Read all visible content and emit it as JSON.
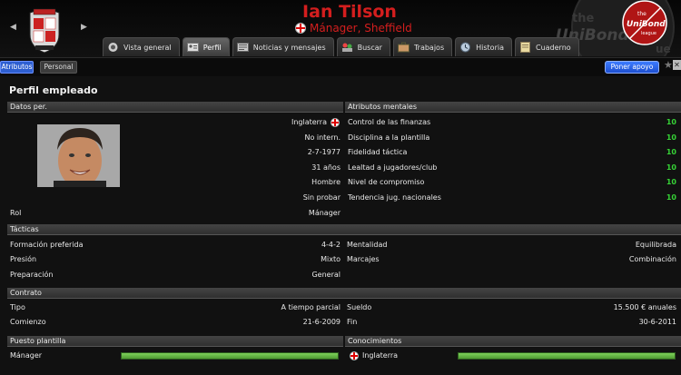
{
  "header": {
    "name": "Ian Tilson",
    "role_club": "Mánager, Sheffield",
    "watermark_top": "the",
    "watermark_mid": "UniBond",
    "watermark_bottom": "ue",
    "badge_top": "the",
    "badge_mid": "UniBond",
    "badge_bottom": "league"
  },
  "tabs": [
    {
      "label": "Vista general",
      "icon": "overview-icon"
    },
    {
      "label": "Perfil",
      "icon": "profile-card-icon",
      "active": true
    },
    {
      "label": "Noticias y mensajes",
      "icon": "news-icon"
    },
    {
      "label": "Buscar",
      "icon": "search-people-icon"
    },
    {
      "label": "Trabajos",
      "icon": "briefcase-icon"
    },
    {
      "label": "Historia",
      "icon": "history-icon"
    },
    {
      "label": "Cuaderno",
      "icon": "notebook-icon"
    }
  ],
  "subtabs": {
    "atributos": "Atributos",
    "personal": "Personal",
    "poner_apoyo": "Poner apoyo"
  },
  "page_title": "Perfil empleado",
  "datos": {
    "heading": "Datos per.",
    "nationality": "Inglaterra",
    "intl": "No intern.",
    "dob": "2-7-1977",
    "age": "31 años",
    "gender": "Hombre",
    "badges": "Sin probar",
    "role_label": "Rol",
    "role_value": "Mánager"
  },
  "mental": {
    "heading": "Atributos mentales",
    "items": [
      {
        "label": "Control de las finanzas",
        "value": "10"
      },
      {
        "label": "Disciplina a la plantilla",
        "value": "10"
      },
      {
        "label": "Fidelidad táctica",
        "value": "10"
      },
      {
        "label": "Lealtad a jugadores/club",
        "value": "10"
      },
      {
        "label": "Nivel de compromiso",
        "value": "10"
      },
      {
        "label": "Tendencia jug. nacionales",
        "value": "10"
      }
    ]
  },
  "tacticas": {
    "heading": "Tácticas",
    "formation_label": "Formación preferida",
    "formation": "4-4-2",
    "mentality_label": "Mentalidad",
    "mentality": "Equilibrada",
    "pressing_label": "Presión",
    "pressing": "Mixto",
    "marking_label": "Marcajes",
    "marking": "Combinación",
    "prep_label": "Preparación",
    "prep": "General"
  },
  "contrato": {
    "heading": "Contrato",
    "type_label": "Tipo",
    "type": "A tiempo parcial",
    "wage_label": "Sueldo",
    "wage": "15.500 € anuales",
    "start_label": "Comienzo",
    "start": "21-6-2009",
    "end_label": "Fin",
    "end": "30-6-2011"
  },
  "puesto": {
    "heading": "Puesto plantilla",
    "role": "Mánager",
    "level": 1.0
  },
  "conocimientos": {
    "heading": "Conocimientos",
    "nation": "Inglaterra",
    "level": 1.0
  }
}
